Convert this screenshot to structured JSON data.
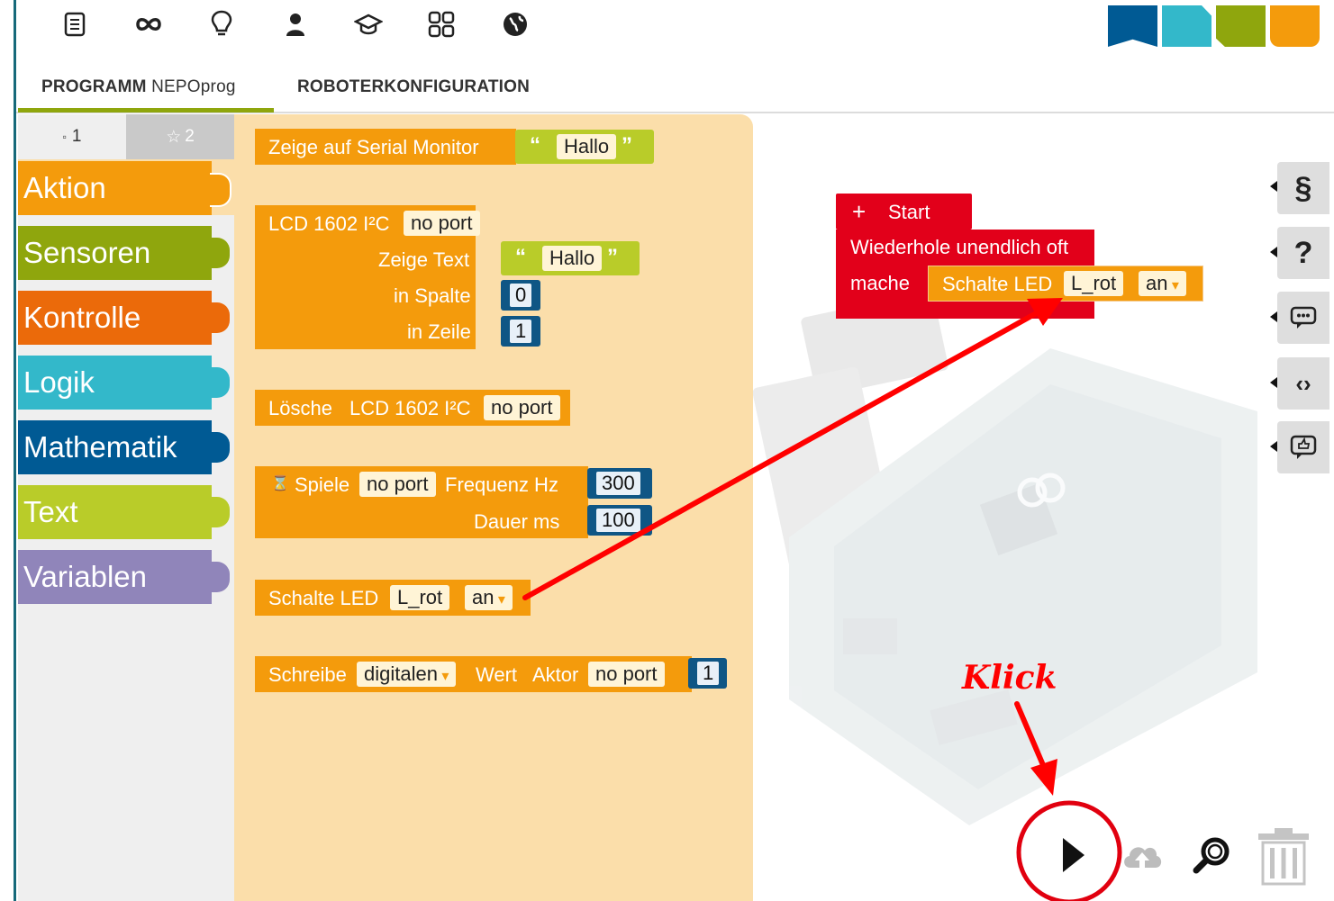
{
  "nav": {
    "icons": [
      "document-icon",
      "infinity-icon",
      "lightbulb-icon",
      "user-icon",
      "graduation-cap-icon",
      "apps-grid-icon",
      "globe-icon"
    ]
  },
  "tabs": {
    "program_bold": "PROGRAMM",
    "program_name": "NEPOprog",
    "robot_config": "ROBOTERKONFIGURATION"
  },
  "toolbox": {
    "level1": "1",
    "level2": "2",
    "categories": [
      {
        "label": "Aktion",
        "color": "#f49b0c"
      },
      {
        "label": "Sensoren",
        "color": "#8fa60d"
      },
      {
        "label": "Kontrolle",
        "color": "#eb6a0a"
      },
      {
        "label": "Logik",
        "color": "#33b8ca"
      },
      {
        "label": "Mathematik",
        "color": "#005a94"
      },
      {
        "label": "Text",
        "color": "#b9cc29"
      },
      {
        "label": "Variablen",
        "color": "#9085ba"
      }
    ]
  },
  "flyout": {
    "serial": {
      "label": "Zeige auf Serial Monitor",
      "value": "Hallo"
    },
    "lcd": {
      "title": "LCD 1602 I²C",
      "port": "no port",
      "show_text": "Zeige Text",
      "text_value": "Hallo",
      "in_column": "in Spalte",
      "column_value": "0",
      "in_row": "in Zeile",
      "row_value": "1"
    },
    "clear": {
      "label": "Lösche",
      "device": "LCD 1602 I²C",
      "port": "no port"
    },
    "play": {
      "label": "Spiele",
      "port": "no port",
      "freq_label": "Frequenz Hz",
      "freq_value": "300",
      "dur_label": "Dauer ms",
      "dur_value": "100"
    },
    "led": {
      "label": "Schalte LED",
      "led": "L_rot",
      "state": "an"
    },
    "write": {
      "label": "Schreibe",
      "mode": "digitalen",
      "value_label": "Wert",
      "actor_label": "Aktor",
      "port": "no port",
      "value": "1"
    }
  },
  "workspace": {
    "start_label": "Start",
    "loop_label": "Wiederhole unendlich oft",
    "do_label": "mache",
    "led_label": "Schalte LED",
    "led_value": "L_rot",
    "state_value": "an",
    "annotation": "Klick"
  },
  "side_buttons": [
    "paragraph-icon",
    "help-icon",
    "comment-icon",
    "code-icon",
    "like-icon"
  ],
  "toolbar": [
    "run-icon",
    "cloud-upload-icon",
    "zoom-icon",
    "trash-icon"
  ],
  "colors": {
    "action": "#f49b0c",
    "start": "#e2001a",
    "annotation": "#ff0000"
  }
}
